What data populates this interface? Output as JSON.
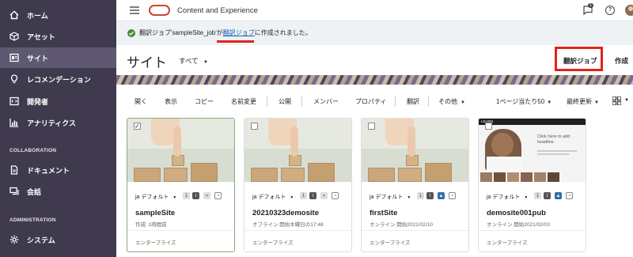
{
  "sidebar": {
    "items": [
      {
        "label": "ホーム",
        "icon": "home-icon"
      },
      {
        "label": "アセット",
        "icon": "cube-icon"
      },
      {
        "label": "サイト",
        "icon": "sites-icon",
        "active": true
      },
      {
        "label": "レコメンデーション",
        "icon": "lightbulb-icon"
      },
      {
        "label": "開発者",
        "icon": "code-icon"
      },
      {
        "label": "アナリティクス",
        "icon": "chart-icon"
      },
      {
        "label": "ドキュメント",
        "icon": "document-icon"
      },
      {
        "label": "会話",
        "icon": "chat-icon"
      },
      {
        "label": "システム",
        "icon": "gear-icon"
      }
    ],
    "sections": {
      "collaboration": "COLLABORATION",
      "administration": "ADMINISTRATION"
    },
    "active_color": "#5e5870",
    "bg_color": "#3f3a4d"
  },
  "header": {
    "app_title": "Content and Experience",
    "notification_count": "1",
    "brand_color": "#c74634"
  },
  "message": {
    "prefix": "翻訳ジョブ'sampleSite_job'が",
    "link": "翻訳ジョブ",
    "suffix": "に作成されました。"
  },
  "page": {
    "title": "サイト",
    "filter": "すべて",
    "translation_job_button": "翻訳ジョブ",
    "create_button": "作成"
  },
  "toolbar": {
    "open": "開く",
    "view": "表示",
    "copy": "コピー",
    "rename": "名前変更",
    "publish": "公開",
    "members": "メンバー",
    "properties": "プロパティ",
    "translate": "翻訳",
    "more": "その他",
    "per_page": "1ページ当たり50",
    "sort": "最終更新"
  },
  "cards": [
    {
      "name": "sampleSite",
      "lang": "ja デフォルト",
      "chip": "1",
      "status": "作成: 1時間前",
      "footer": "エンタープライズ",
      "selected": true,
      "checkbox": "✓",
      "online": false
    },
    {
      "name": "20210323demosite",
      "lang": "ja デフォルト",
      "chip": "1",
      "status": "オフライン 開始木曜日の17:48",
      "footer": "エンタープライズ",
      "selected": false,
      "checkbox": "",
      "online": false
    },
    {
      "name": "firstSite",
      "lang": "ja デフォルト",
      "chip": "1",
      "status": "オンライン 開始2021/02/10",
      "footer": "エンタープライズ",
      "selected": false,
      "checkbox": "",
      "online": true
    },
    {
      "name": "demosite001pub",
      "lang": "ja デフォルト",
      "chip": "1",
      "status": "オンライン 開始2021/02/03",
      "footer": "エンタープライズ",
      "selected": false,
      "checkbox": "",
      "online": true
    }
  ],
  "card4_thumb": {
    "brand": "LEARN",
    "headline": "Click here to add headline"
  }
}
